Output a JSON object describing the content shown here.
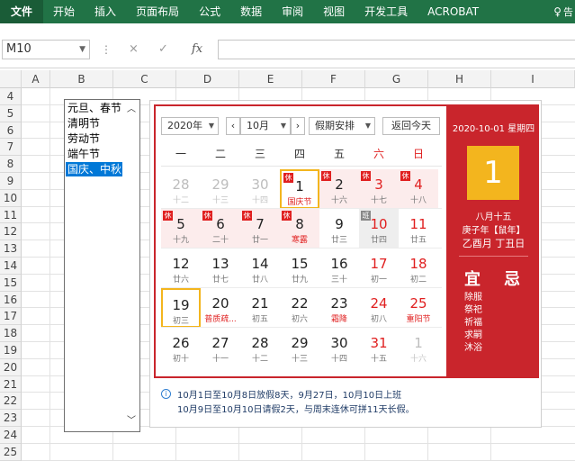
{
  "ribbon": {
    "tabs": [
      {
        "label": "文件",
        "active": true
      },
      {
        "label": "开始"
      },
      {
        "label": "插入"
      },
      {
        "label": "页面布局"
      },
      {
        "label": "公式"
      },
      {
        "label": "数据"
      },
      {
        "label": "审阅"
      },
      {
        "label": "视图"
      },
      {
        "label": "开发工具"
      },
      {
        "label": "ACROBAT"
      }
    ],
    "tellme_icon": "lightbulb-icon",
    "tellme_label": "告"
  },
  "formula_bar": {
    "namebox_value": "M10",
    "fx_label": "fx",
    "cancel_icon": "×",
    "enter_icon": "✓",
    "formula_value": ""
  },
  "grid": {
    "columns": [
      "A",
      "B",
      "C",
      "D",
      "E",
      "F",
      "G",
      "H",
      "I"
    ],
    "rows": [
      "4",
      "5",
      "6",
      "7",
      "8",
      "9",
      "10",
      "11",
      "12",
      "13",
      "14",
      "15",
      "16",
      "17",
      "18",
      "19",
      "20",
      "21",
      "22",
      "23",
      "24",
      "25"
    ]
  },
  "listbox": {
    "items": [
      "元旦、春节",
      "清明节",
      "劳动节",
      "端午节",
      "国庆、中秋"
    ],
    "selected_index": 4
  },
  "calendar": {
    "year_label": "2020年",
    "month_label": "10月",
    "holiday_label": "假期安排",
    "today_button": "返回今天",
    "weekdays": [
      "一",
      "二",
      "三",
      "四",
      "五",
      "六",
      "日"
    ],
    "badge_rest": "休",
    "badge_work": "班",
    "weeks": [
      [
        {
          "d": "28",
          "l": "十二",
          "dim": true
        },
        {
          "d": "29",
          "l": "十三",
          "dim": true
        },
        {
          "d": "30",
          "l": "十四",
          "dim": true
        },
        {
          "d": "1",
          "l": "国庆节",
          "today": true,
          "badge": "rest",
          "fest": true
        },
        {
          "d": "2",
          "l": "十六",
          "badge": "rest",
          "hol": true
        },
        {
          "d": "3",
          "l": "十七",
          "badge": "rest",
          "hol": true,
          "red": true
        },
        {
          "d": "4",
          "l": "十八",
          "badge": "rest",
          "hol": true,
          "red": true
        }
      ],
      [
        {
          "d": "5",
          "l": "十九",
          "badge": "rest",
          "hol": true
        },
        {
          "d": "6",
          "l": "二十",
          "badge": "rest",
          "hol": true
        },
        {
          "d": "7",
          "l": "廿一",
          "badge": "rest",
          "hol": true
        },
        {
          "d": "8",
          "l": "寒露",
          "badge": "rest",
          "hol": true,
          "fest": true
        },
        {
          "d": "9",
          "l": "廿三"
        },
        {
          "d": "10",
          "l": "廿四",
          "badge": "work",
          "work": true,
          "red": true
        },
        {
          "d": "11",
          "l": "廿五",
          "red": true
        }
      ],
      [
        {
          "d": "12",
          "l": "廿六"
        },
        {
          "d": "13",
          "l": "廿七"
        },
        {
          "d": "14",
          "l": "廿八"
        },
        {
          "d": "15",
          "l": "廿九"
        },
        {
          "d": "16",
          "l": "三十"
        },
        {
          "d": "17",
          "l": "初一",
          "red": true
        },
        {
          "d": "18",
          "l": "初二",
          "red": true
        }
      ],
      [
        {
          "d": "19",
          "l": "初三",
          "sel": true
        },
        {
          "d": "20",
          "l": "普质疏...",
          "fest": true
        },
        {
          "d": "21",
          "l": "初五"
        },
        {
          "d": "22",
          "l": "初六"
        },
        {
          "d": "23",
          "l": "霜降",
          "fest": true
        },
        {
          "d": "24",
          "l": "初八",
          "red": true
        },
        {
          "d": "25",
          "l": "重阳节",
          "red": true,
          "fest": true
        }
      ],
      [
        {
          "d": "26",
          "l": "初十"
        },
        {
          "d": "27",
          "l": "十一"
        },
        {
          "d": "28",
          "l": "十二"
        },
        {
          "d": "29",
          "l": "十三"
        },
        {
          "d": "30",
          "l": "十四"
        },
        {
          "d": "31",
          "l": "十五",
          "red": true
        },
        {
          "d": "1",
          "l": "十六",
          "dim": true
        }
      ]
    ],
    "side": {
      "date": "2020-10-01 星期四",
      "big_day": "1",
      "lunar": "八月十五",
      "ganzhi_year": "庚子年【鼠年】",
      "ganzhi_month": "乙酉月 丁丑日",
      "yi": "宜",
      "ji": "忌",
      "yi_items": [
        "除服",
        "祭祀",
        "祈福",
        "求嗣",
        "沐浴"
      ]
    },
    "notes": [
      "10月1日至10月8日放假8天，9月27日，10月10日上班",
      "10月9日至10月10日请假2天，与周末连休可拼11天长假。"
    ]
  },
  "colors": {
    "excel_green": "#217346",
    "calendar_red": "#c9252c",
    "accent_yellow": "#f3b51e"
  }
}
